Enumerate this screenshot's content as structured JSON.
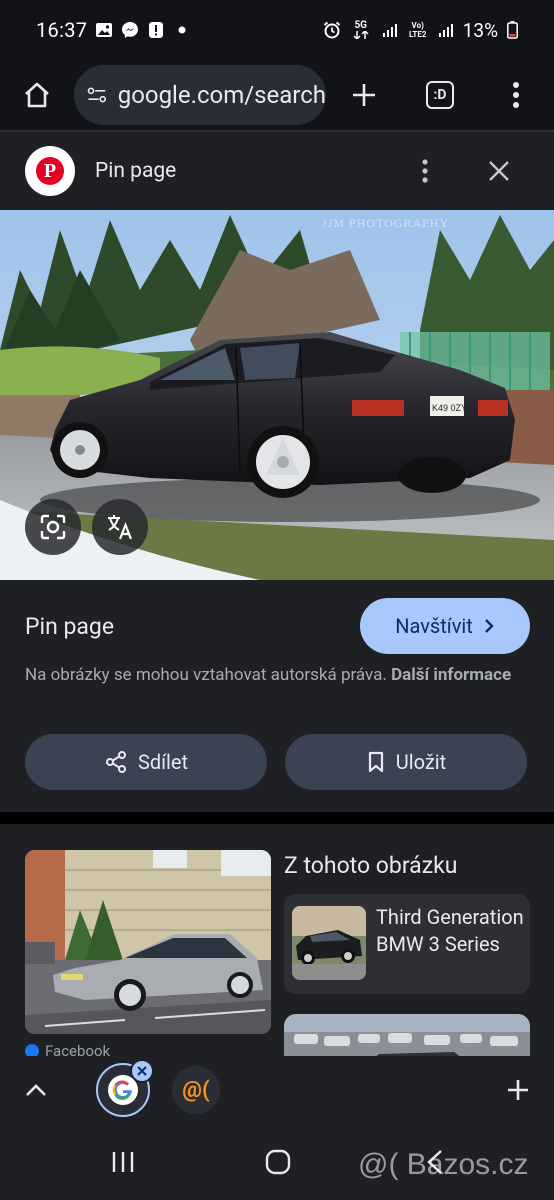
{
  "status_bar": {
    "time": "16:37",
    "network_label": "5G",
    "volte_label": "Vo) LTE2",
    "battery_percent": "13%"
  },
  "toolbar": {
    "url": "google.com/search",
    "tab_count": ":D"
  },
  "panel": {
    "header_title": "Pin page",
    "image_watermark": "JJM PHOTOGRAPHY",
    "site_title": "Pin page",
    "visit_label": "Navštívit",
    "copyright_text": "Na obrázky se mohou vztahovat autorská práva.",
    "copyright_link": "Další informace",
    "share_label": "Sdílet",
    "save_label": "Uložit"
  },
  "results": {
    "source_label": "Facebook",
    "section_title": "Z tohoto obrázku",
    "related_label": "Third Generation BMW 3 Series"
  },
  "bottom_tabs": {
    "bazos_icon_text": "@("
  },
  "overlay": {
    "watermark": "@( Bazos.cz"
  },
  "colors": {
    "accent": "#a8c7fa",
    "panel_bg": "#1f2024",
    "pinterest_red": "#e60023"
  }
}
